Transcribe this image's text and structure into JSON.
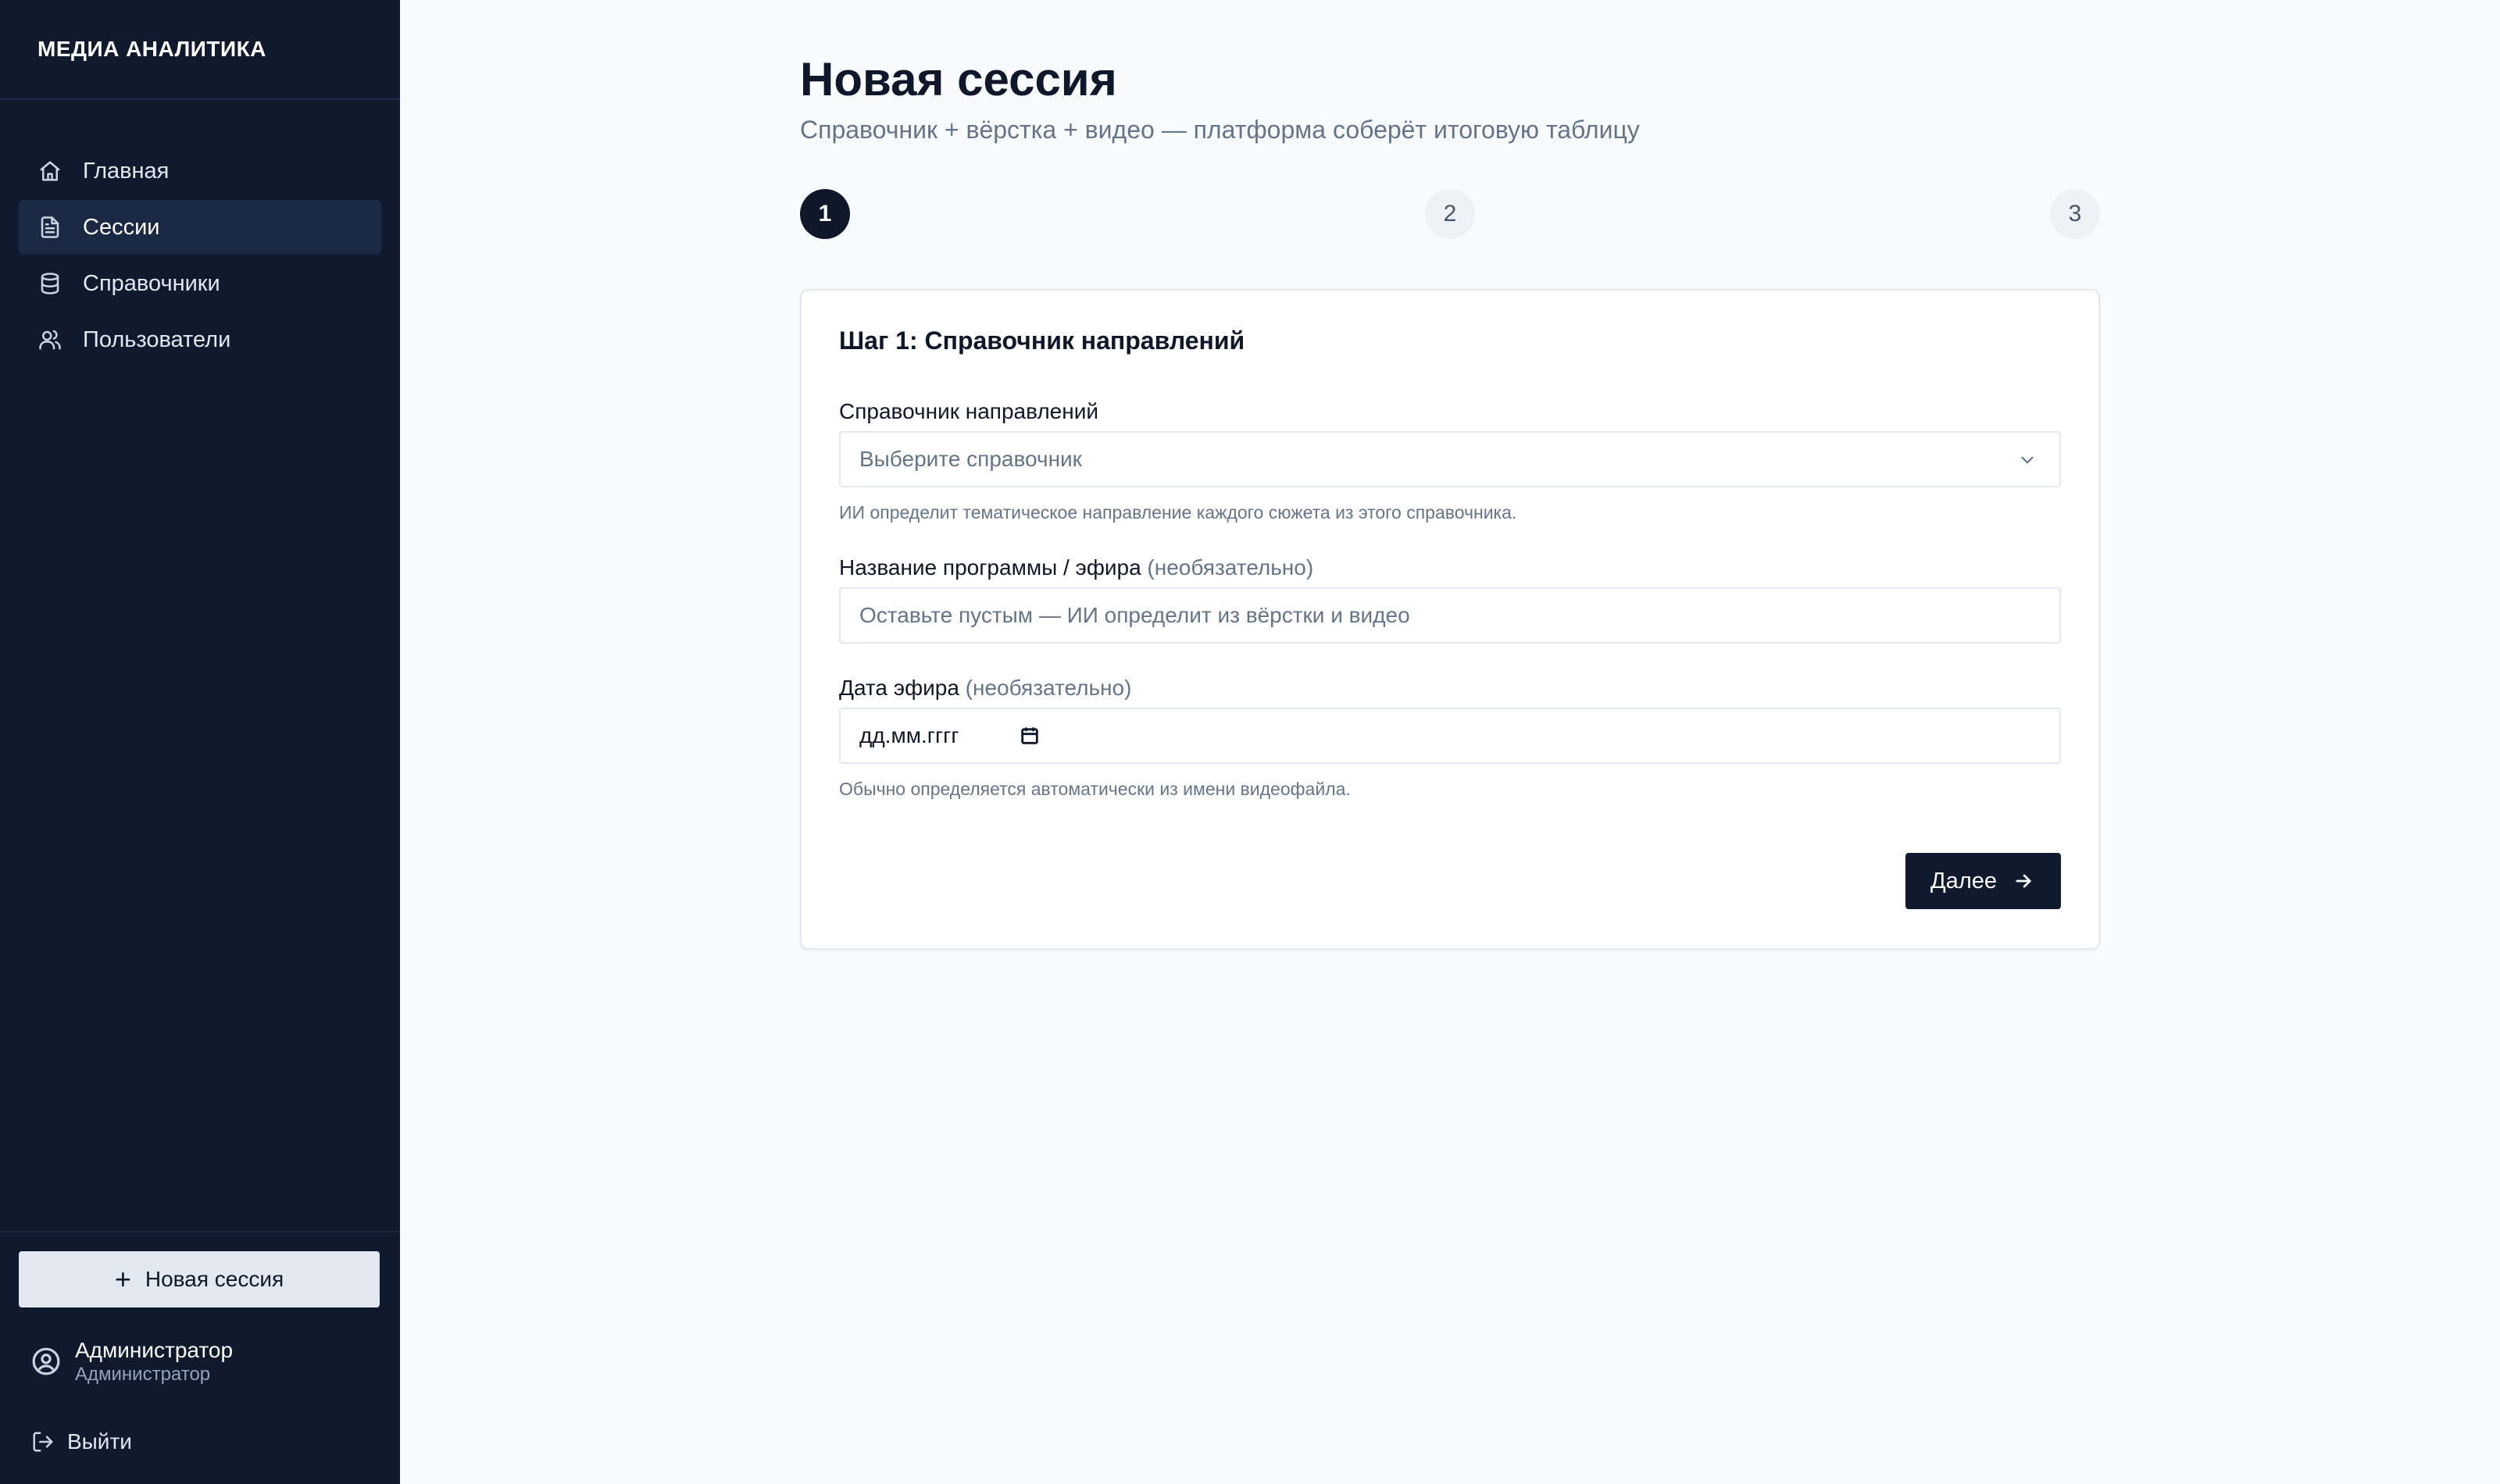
{
  "app": {
    "brand": "МЕДИА АНАЛИТИКА"
  },
  "sidebar": {
    "items": [
      {
        "label": "Главная",
        "icon": "home-icon",
        "active": false
      },
      {
        "label": "Сессии",
        "icon": "document-icon",
        "active": true
      },
      {
        "label": "Справочники",
        "icon": "database-icon",
        "active": false
      },
      {
        "label": "Пользователи",
        "icon": "users-icon",
        "active": false
      }
    ],
    "new_session_label": "Новая сессия",
    "user": {
      "name": "Администратор",
      "role": "Администратор"
    },
    "logout_label": "Выйти"
  },
  "page": {
    "title": "Новая сессия",
    "subtitle": "Справочник + вёрстка + видео — платформа соберёт итоговую таблицу"
  },
  "stepper": {
    "steps": [
      "1",
      "2",
      "3"
    ],
    "current": 1
  },
  "form": {
    "card_title": "Шаг 1: Справочник направлений",
    "directory": {
      "label": "Справочник направлений",
      "placeholder": "Выберите справочник",
      "hint": "ИИ определит тематическое направление каждого сюжета из этого справочника."
    },
    "program": {
      "label": "Название программы / эфира",
      "optional": "(необязательно)",
      "placeholder": "Оставьте пустым — ИИ определит из вёрстки и видео"
    },
    "air_date": {
      "label": "Дата эфира",
      "optional": "(необязательно)",
      "placeholder": "дд.мм.гггг",
      "hint": "Обычно определяется автоматически из имени видеофайла."
    },
    "next_label": "Далее"
  },
  "colors": {
    "sidebar_bg": "#101a2e",
    "active_item_bg": "#1a2844",
    "page_bg": "#f8fafc",
    "accent": "#0f172a",
    "muted": "#64748b"
  }
}
